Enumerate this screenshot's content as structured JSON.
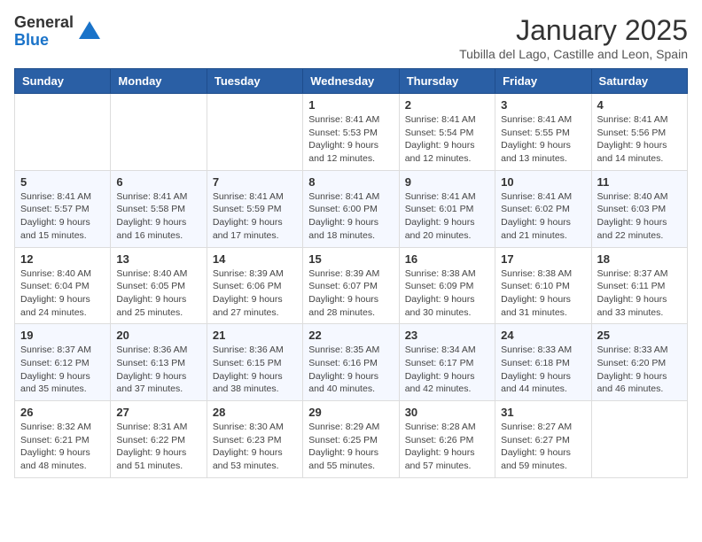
{
  "logo": {
    "general": "General",
    "blue": "Blue"
  },
  "title": {
    "month": "January 2025",
    "location": "Tubilla del Lago, Castille and Leon, Spain"
  },
  "weekdays": [
    "Sunday",
    "Monday",
    "Tuesday",
    "Wednesday",
    "Thursday",
    "Friday",
    "Saturday"
  ],
  "weeks": [
    [
      {
        "date": "",
        "info": ""
      },
      {
        "date": "",
        "info": ""
      },
      {
        "date": "",
        "info": ""
      },
      {
        "date": "1",
        "info": "Sunrise: 8:41 AM\nSunset: 5:53 PM\nDaylight: 9 hours and 12 minutes."
      },
      {
        "date": "2",
        "info": "Sunrise: 8:41 AM\nSunset: 5:54 PM\nDaylight: 9 hours and 12 minutes."
      },
      {
        "date": "3",
        "info": "Sunrise: 8:41 AM\nSunset: 5:55 PM\nDaylight: 9 hours and 13 minutes."
      },
      {
        "date": "4",
        "info": "Sunrise: 8:41 AM\nSunset: 5:56 PM\nDaylight: 9 hours and 14 minutes."
      }
    ],
    [
      {
        "date": "5",
        "info": "Sunrise: 8:41 AM\nSunset: 5:57 PM\nDaylight: 9 hours and 15 minutes."
      },
      {
        "date": "6",
        "info": "Sunrise: 8:41 AM\nSunset: 5:58 PM\nDaylight: 9 hours and 16 minutes."
      },
      {
        "date": "7",
        "info": "Sunrise: 8:41 AM\nSunset: 5:59 PM\nDaylight: 9 hours and 17 minutes."
      },
      {
        "date": "8",
        "info": "Sunrise: 8:41 AM\nSunset: 6:00 PM\nDaylight: 9 hours and 18 minutes."
      },
      {
        "date": "9",
        "info": "Sunrise: 8:41 AM\nSunset: 6:01 PM\nDaylight: 9 hours and 20 minutes."
      },
      {
        "date": "10",
        "info": "Sunrise: 8:41 AM\nSunset: 6:02 PM\nDaylight: 9 hours and 21 minutes."
      },
      {
        "date": "11",
        "info": "Sunrise: 8:40 AM\nSunset: 6:03 PM\nDaylight: 9 hours and 22 minutes."
      }
    ],
    [
      {
        "date": "12",
        "info": "Sunrise: 8:40 AM\nSunset: 6:04 PM\nDaylight: 9 hours and 24 minutes."
      },
      {
        "date": "13",
        "info": "Sunrise: 8:40 AM\nSunset: 6:05 PM\nDaylight: 9 hours and 25 minutes."
      },
      {
        "date": "14",
        "info": "Sunrise: 8:39 AM\nSunset: 6:06 PM\nDaylight: 9 hours and 27 minutes."
      },
      {
        "date": "15",
        "info": "Sunrise: 8:39 AM\nSunset: 6:07 PM\nDaylight: 9 hours and 28 minutes."
      },
      {
        "date": "16",
        "info": "Sunrise: 8:38 AM\nSunset: 6:09 PM\nDaylight: 9 hours and 30 minutes."
      },
      {
        "date": "17",
        "info": "Sunrise: 8:38 AM\nSunset: 6:10 PM\nDaylight: 9 hours and 31 minutes."
      },
      {
        "date": "18",
        "info": "Sunrise: 8:37 AM\nSunset: 6:11 PM\nDaylight: 9 hours and 33 minutes."
      }
    ],
    [
      {
        "date": "19",
        "info": "Sunrise: 8:37 AM\nSunset: 6:12 PM\nDaylight: 9 hours and 35 minutes."
      },
      {
        "date": "20",
        "info": "Sunrise: 8:36 AM\nSunset: 6:13 PM\nDaylight: 9 hours and 37 minutes."
      },
      {
        "date": "21",
        "info": "Sunrise: 8:36 AM\nSunset: 6:15 PM\nDaylight: 9 hours and 38 minutes."
      },
      {
        "date": "22",
        "info": "Sunrise: 8:35 AM\nSunset: 6:16 PM\nDaylight: 9 hours and 40 minutes."
      },
      {
        "date": "23",
        "info": "Sunrise: 8:34 AM\nSunset: 6:17 PM\nDaylight: 9 hours and 42 minutes."
      },
      {
        "date": "24",
        "info": "Sunrise: 8:33 AM\nSunset: 6:18 PM\nDaylight: 9 hours and 44 minutes."
      },
      {
        "date": "25",
        "info": "Sunrise: 8:33 AM\nSunset: 6:20 PM\nDaylight: 9 hours and 46 minutes."
      }
    ],
    [
      {
        "date": "26",
        "info": "Sunrise: 8:32 AM\nSunset: 6:21 PM\nDaylight: 9 hours and 48 minutes."
      },
      {
        "date": "27",
        "info": "Sunrise: 8:31 AM\nSunset: 6:22 PM\nDaylight: 9 hours and 51 minutes."
      },
      {
        "date": "28",
        "info": "Sunrise: 8:30 AM\nSunset: 6:23 PM\nDaylight: 9 hours and 53 minutes."
      },
      {
        "date": "29",
        "info": "Sunrise: 8:29 AM\nSunset: 6:25 PM\nDaylight: 9 hours and 55 minutes."
      },
      {
        "date": "30",
        "info": "Sunrise: 8:28 AM\nSunset: 6:26 PM\nDaylight: 9 hours and 57 minutes."
      },
      {
        "date": "31",
        "info": "Sunrise: 8:27 AM\nSunset: 6:27 PM\nDaylight: 9 hours and 59 minutes."
      },
      {
        "date": "",
        "info": ""
      }
    ]
  ]
}
